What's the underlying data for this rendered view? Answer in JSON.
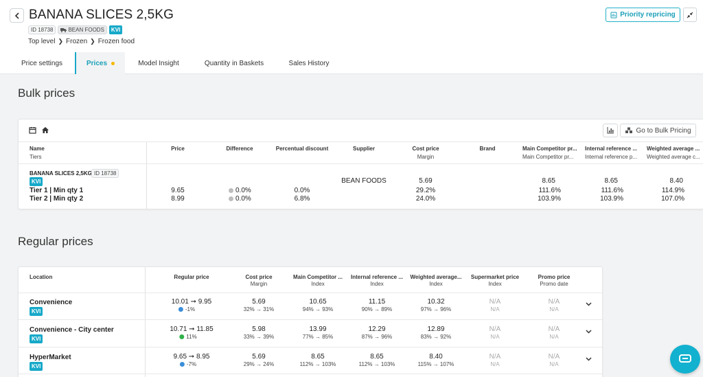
{
  "header": {
    "title": "BANANA SLICES 2,5KG",
    "id_tag": "ID 18738",
    "supplier_tag": "BEAN FOODS",
    "kvi": "KVI",
    "breadcrumb": [
      "Top level",
      "Frozen",
      "Frozen food"
    ],
    "priority_button": "Priority repricing"
  },
  "tabs": [
    {
      "label": "Price settings"
    },
    {
      "label": "Prices"
    },
    {
      "label": "Model Insight"
    },
    {
      "label": "Quantity in Baskets"
    },
    {
      "label": "Sales History"
    }
  ],
  "bulk": {
    "section_title": "Bulk prices",
    "go_button": "Go to Bulk Pricing",
    "headers": {
      "name": "Name",
      "name_sub": "Tiers",
      "price": "Price",
      "difference": "Difference",
      "percentual_discount": "Percentual discount",
      "supplier": "Supplier",
      "cost_price": "Cost price",
      "cost_sub": "Margin",
      "brand": "Brand",
      "main_comp": "Main Competitor pr...",
      "main_comp_sub": "Main Competitor pr...",
      "internal_ref": "Internal reference ...",
      "internal_ref_sub": "Internal reference p...",
      "weighted": "Weighted average ...",
      "weighted_sub": "Weighted average c..."
    },
    "product": {
      "name": "BANANA SLICES 2,5KG",
      "id": "ID 18738",
      "kvi": "KVI",
      "supplier": "BEAN FOODS",
      "cost_price": "5.69",
      "main_comp": "8.65",
      "internal_ref": "8.65",
      "weighted": "8.40"
    },
    "tiers": [
      {
        "name": "Tier 1 | Min qty 1",
        "price": "9.65",
        "difference": "0.0%",
        "discount": "0.0%",
        "margin": "29.2%",
        "main_comp": "111.6%",
        "internal_ref": "111.6%",
        "weighted": "114.9%"
      },
      {
        "name": "Tier 2 | Min qty 2",
        "price": "8.99",
        "difference": "0.0%",
        "discount": "6.8%",
        "margin": "24.0%",
        "main_comp": "103.9%",
        "internal_ref": "103.9%",
        "weighted": "107.0%"
      }
    ]
  },
  "regular": {
    "section_title": "Regular prices",
    "headers": {
      "location": "Location",
      "regular_price": "Regular price",
      "cost_price": "Cost price",
      "cost_sub": "Margin",
      "main_comp": "Main Competitor ...",
      "main_comp_sub": "Index",
      "internal_ref": "Internal reference ...",
      "internal_ref_sub": "Index",
      "weighted": "Weighted average...",
      "weighted_sub": "Index",
      "supermarket": "Supermarket price",
      "supermarket_sub": "Index",
      "promo": "Promo price",
      "promo_sub": "Promo date"
    },
    "rows": [
      {
        "location": "Convenience",
        "kvi": "KVI",
        "price_from": "10.01",
        "price_to": "9.95",
        "change": "-1%",
        "change_color": "#3b8ed8",
        "cost": "5.69",
        "margin": "32% → 31%",
        "main_comp": "10.65",
        "main_idx": "94% → 93%",
        "internal": "11.15",
        "internal_idx": "90% → 89%",
        "weighted": "10.32",
        "weighted_idx": "97% → 96%",
        "super": "N/A",
        "super_idx": "N/A",
        "promo": "N/A",
        "promo_date": "N/A"
      },
      {
        "location": "Convenience - City center",
        "kvi": "KVI",
        "price_from": "10.71",
        "price_to": "11.85",
        "change": "11%",
        "change_color": "#2fb24b",
        "cost": "5.98",
        "margin": "33% → 39%",
        "main_comp": "13.99",
        "main_idx": "77% → 85%",
        "internal": "12.29",
        "internal_idx": "87% → 96%",
        "weighted": "12.89",
        "weighted_idx": "83% → 92%",
        "super": "N/A",
        "super_idx": "N/A",
        "promo": "N/A",
        "promo_date": "N/A"
      },
      {
        "location": "HyperMarket",
        "kvi": "KVI",
        "price_from": "9.65",
        "price_to": "8.95",
        "change": "-7%",
        "change_color": "#3b8ed8",
        "cost": "5.69",
        "margin": "29% → 24%",
        "main_comp": "8.65",
        "main_idx": "112% → 103%",
        "internal": "8.65",
        "internal_idx": "112% → 103%",
        "weighted": "8.40",
        "weighted_idx": "115% → 107%",
        "super": "N/A",
        "super_idx": "N/A",
        "promo": "N/A",
        "promo_date": "N/A"
      }
    ]
  }
}
